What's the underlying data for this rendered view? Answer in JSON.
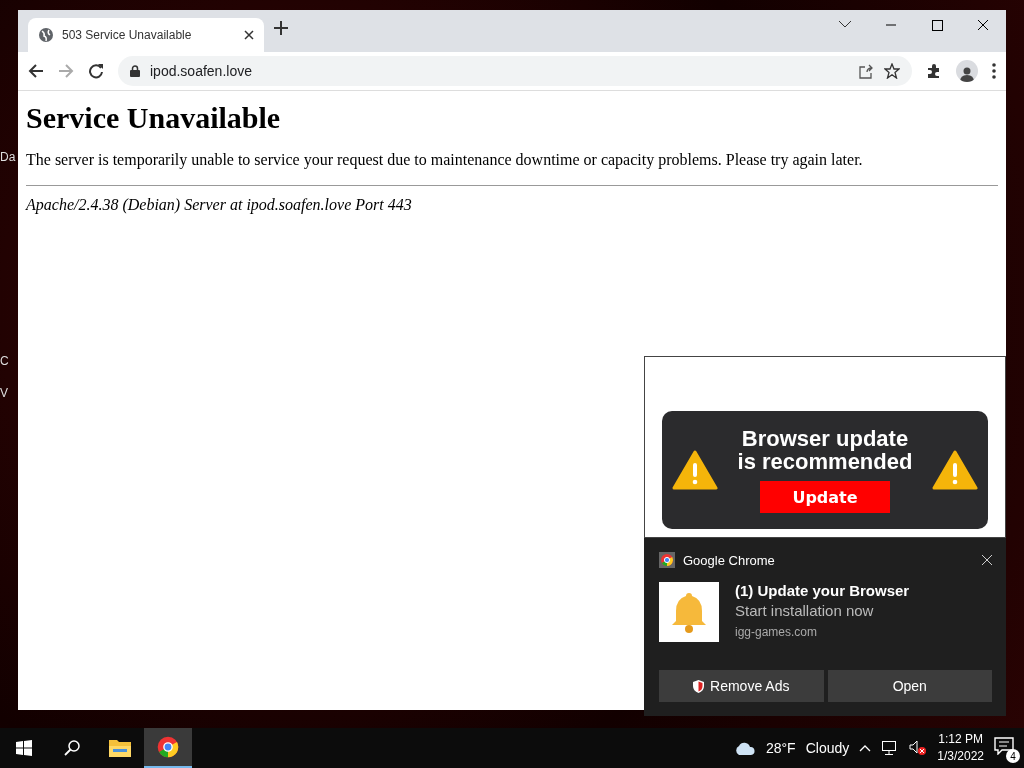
{
  "desktop_icons": [
    {
      "label": "Da"
    },
    {
      "label": "C"
    },
    {
      "label": "V"
    }
  ],
  "browser": {
    "tabs": [
      {
        "title": "503 Service Unavailable",
        "selected": true
      }
    ],
    "address": "ipod.soafen.love",
    "page": {
      "heading": "Service Unavailable",
      "message": "The server is temporarily unable to service your request due to maintenance downtime or capacity problems. Please try again later.",
      "footer": "Apache/2.4.38 (Debian) Server at ipod.soafen.love Port 443"
    }
  },
  "ad_popup": {
    "headline_1": "Browser update",
    "headline_2": "is recommended",
    "button": "Update"
  },
  "notification": {
    "app": "Google Chrome",
    "title": "(1) Update your Browser",
    "body": "Start installation now",
    "source": "igg-games.com",
    "buttons": [
      "Remove Ads",
      "Open"
    ]
  },
  "taskbar": {
    "apps": [
      {
        "kind": "explorer",
        "active": false
      },
      {
        "kind": "chrome",
        "active": true
      }
    ],
    "weather": {
      "temperature": "28°F",
      "condition": "Cloudy"
    },
    "time": "1:12 PM",
    "date": "1/3/2022",
    "notification_count": "4"
  }
}
